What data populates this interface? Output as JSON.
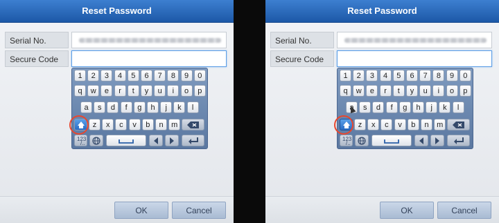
{
  "dialog": {
    "title": "Reset Password",
    "serial_label": "Serial No.",
    "code_label": "Secure Code",
    "ok_label": "OK",
    "cancel_label": "Cancel"
  },
  "keyboard": {
    "numbers": [
      "1",
      "2",
      "3",
      "4",
      "5",
      "6",
      "7",
      "8",
      "9",
      "0"
    ],
    "row_q": [
      "q",
      "w",
      "e",
      "r",
      "t",
      "y",
      "u",
      "i",
      "o",
      "p"
    ],
    "row_a": [
      "a",
      "s",
      "d",
      "f",
      "g",
      "h",
      "j",
      "k",
      "l"
    ],
    "row_z": [
      "z",
      "x",
      "c",
      "v",
      "b",
      "n",
      "m"
    ],
    "mode_label_top": "123",
    "mode_label_bottom": "/..",
    "backspace_icon": "backspace-icon",
    "globe_icon": "globe-icon",
    "space_icon": "space-icon",
    "left_icon": "arrow-left-icon",
    "right_icon": "arrow-right-icon",
    "enter_icon": "enter-icon",
    "shift_icon": "shift-icon"
  },
  "colors": {
    "title_bar": "#1c58a7",
    "highlight": "#e8472e",
    "shift_active": "#2a6cc4"
  },
  "state": {
    "left_panel_shift_active": false,
    "right_panel_shift_active": true
  }
}
